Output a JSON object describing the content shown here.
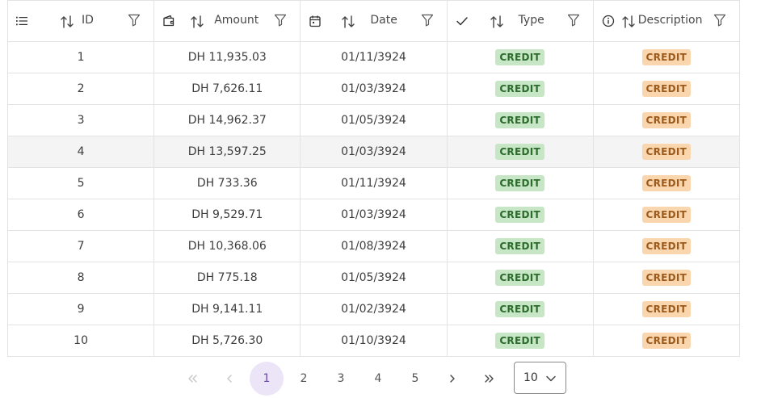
{
  "table": {
    "columns": [
      {
        "icon": "list-icon",
        "label": "ID"
      },
      {
        "icon": "wallet-icon",
        "label": "Amount"
      },
      {
        "icon": "calendar-icon",
        "label": "Date"
      },
      {
        "icon": "check-icon",
        "label": "Type"
      },
      {
        "icon": "info-icon",
        "label": "Description"
      }
    ],
    "rows": [
      {
        "id": "1",
        "amount": "DH 11,935.03",
        "date": "01/11/3924",
        "type": "CREDIT",
        "description": "CREDIT"
      },
      {
        "id": "2",
        "amount": "DH 7,626.11",
        "date": "01/03/3924",
        "type": "CREDIT",
        "description": "CREDIT"
      },
      {
        "id": "3",
        "amount": "DH 14,962.37",
        "date": "01/05/3924",
        "type": "CREDIT",
        "description": "CREDIT"
      },
      {
        "id": "4",
        "amount": "DH 13,597.25",
        "date": "01/03/3924",
        "type": "CREDIT",
        "description": "CREDIT"
      },
      {
        "id": "5",
        "amount": "DH 733.36",
        "date": "01/11/3924",
        "type": "CREDIT",
        "description": "CREDIT"
      },
      {
        "id": "6",
        "amount": "DH 9,529.71",
        "date": "01/03/3924",
        "type": "CREDIT",
        "description": "CREDIT"
      },
      {
        "id": "7",
        "amount": "DH 10,368.06",
        "date": "01/08/3924",
        "type": "CREDIT",
        "description": "CREDIT"
      },
      {
        "id": "8",
        "amount": "DH 775.18",
        "date": "01/05/3924",
        "type": "CREDIT",
        "description": "CREDIT"
      },
      {
        "id": "9",
        "amount": "DH 9,141.11",
        "date": "01/02/3924",
        "type": "CREDIT",
        "description": "CREDIT"
      },
      {
        "id": "10",
        "amount": "DH 5,726.30",
        "date": "01/10/3924",
        "type": "CREDIT",
        "description": "CREDIT"
      }
    ],
    "hovered_row": "4",
    "colors": {
      "type_badge_bg": "#c6e6c5",
      "type_badge_fg": "#2d6b2d",
      "desc_badge_bg": "#f9d6ad",
      "desc_badge_fg": "#9c5b1c"
    }
  },
  "pagination": {
    "pages": [
      "1",
      "2",
      "3",
      "4",
      "5"
    ],
    "current_page": "1",
    "rows_per_page": "10",
    "accent": "#6a4aa8"
  }
}
